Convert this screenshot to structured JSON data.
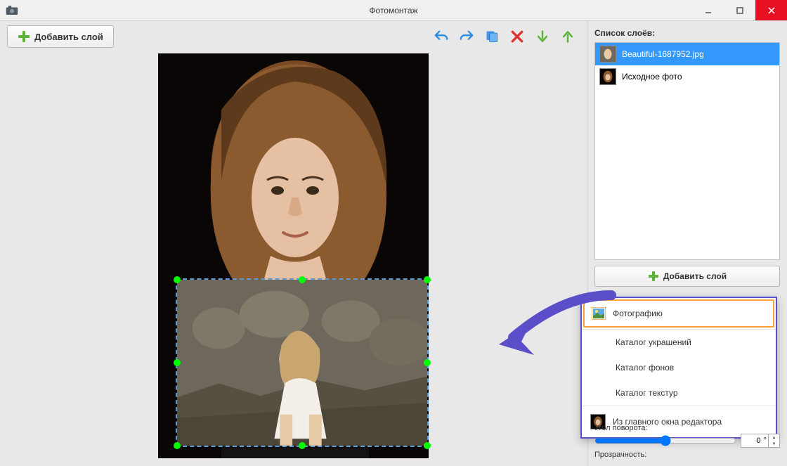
{
  "window": {
    "title": "Фотомонтаж"
  },
  "toolbar": {
    "add_layer": "Добавить слой"
  },
  "sidebar": {
    "title": "Список слоёв:",
    "layers": [
      {
        "name": "Beautiful-1687952.jpg",
        "selected": true
      },
      {
        "name": "Исходное фото",
        "selected": false
      }
    ],
    "add_layer": "Добавить слой",
    "popup": {
      "items": [
        {
          "label": "Фотографию",
          "selected": true
        },
        {
          "label": "Каталог украшений"
        },
        {
          "label": "Каталог фонов"
        },
        {
          "label": "Каталог текстур"
        },
        {
          "label": "Из главного окна редактора"
        }
      ]
    },
    "rotation": {
      "label": "Угол поворота:",
      "value": "0"
    },
    "opacity": {
      "label": "Прозрачность:"
    }
  }
}
